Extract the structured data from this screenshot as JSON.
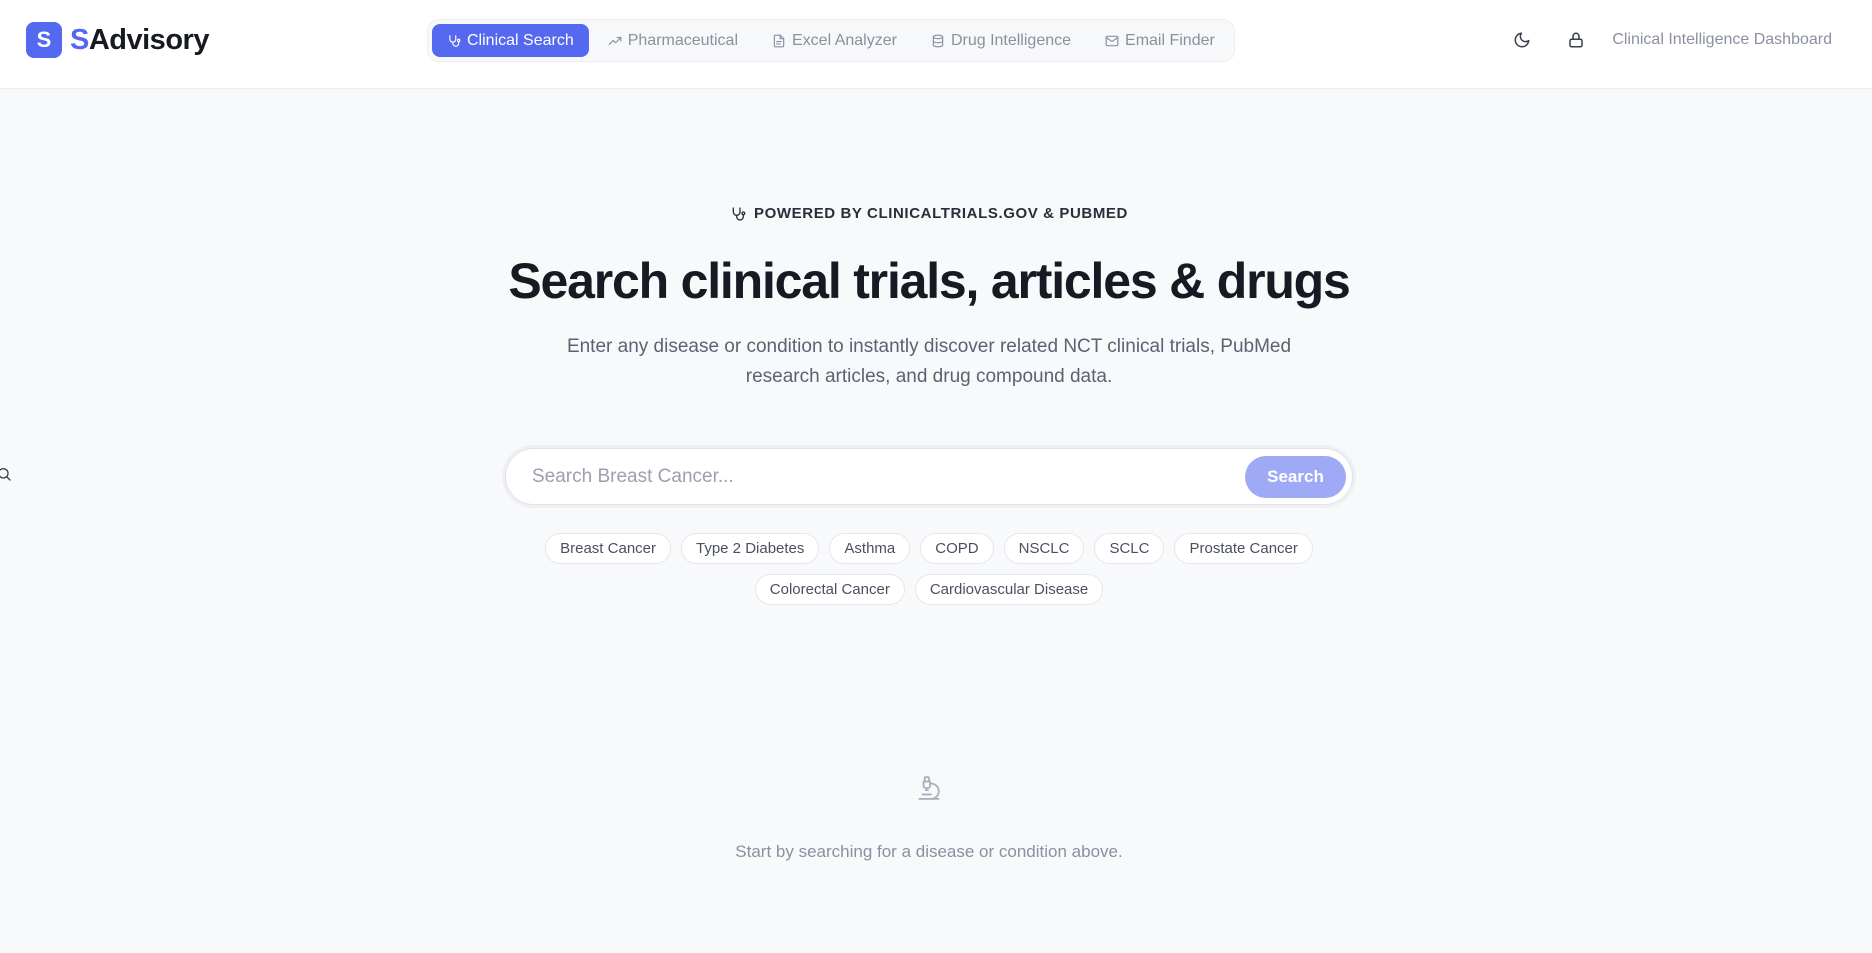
{
  "header": {
    "logo": {
      "mark": "S",
      "accent": "S",
      "rest": "Advisory"
    },
    "nav": [
      {
        "label": "Clinical Search",
        "icon": "stethoscope-icon",
        "active": true
      },
      {
        "label": "Pharmaceutical",
        "icon": "trending-up-icon",
        "active": false
      },
      {
        "label": "Excel Analyzer",
        "icon": "file-icon",
        "active": false
      },
      {
        "label": "Drug Intelligence",
        "icon": "database-icon",
        "active": false
      },
      {
        "label": "Email Finder",
        "icon": "mail-icon",
        "active": false
      }
    ],
    "dashboard_label": "Clinical Intelligence Dashboard"
  },
  "hero": {
    "eyebrow": "POWERED BY CLINICALTRIALS.GOV & PUBMED",
    "title": "Search clinical trials, articles & drugs",
    "subtitle": "Enter any disease or condition to instantly discover related NCT clinical trials, PubMed research articles, and drug compound data."
  },
  "search": {
    "placeholder": "Search Breast Cancer...",
    "value": "",
    "button_label": "Search"
  },
  "chips": [
    "Breast Cancer",
    "Type 2 Diabetes",
    "Asthma",
    "COPD",
    "NSCLC",
    "SCLC",
    "Prostate Cancer",
    "Colorectal Cancer",
    "Cardiovascular Disease"
  ],
  "empty_state": {
    "icon": "microscope-icon",
    "text": "Start by searching for a disease or condition above."
  },
  "colors": {
    "accent": "#5468f0",
    "search_button": "#9eaaf6",
    "background": "#f8f9fb"
  }
}
